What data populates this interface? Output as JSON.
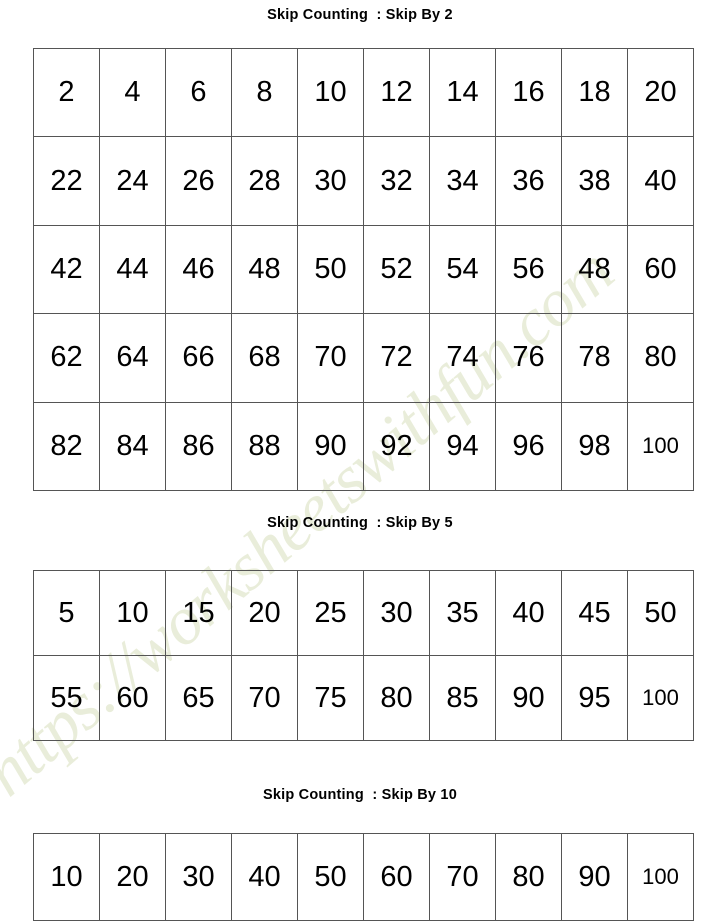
{
  "watermark": {
    "text": "https://worksheetswithfun.com",
    "color": "#e9edda"
  },
  "sections": [
    {
      "id": "skip-2",
      "title": "Skip Counting  : Skip By 2",
      "step": 2,
      "rows": [
        [
          "2",
          "4",
          "6",
          "8",
          "10",
          "12",
          "14",
          "16",
          "18",
          "20"
        ],
        [
          "22",
          "24",
          "26",
          "28",
          "30",
          "32",
          "34",
          "36",
          "38",
          "40"
        ],
        [
          "42",
          "44",
          "46",
          "48",
          "50",
          "52",
          "54",
          "56",
          "48",
          "60"
        ],
        [
          "62",
          "64",
          "66",
          "68",
          "70",
          "72",
          "74",
          "76",
          "78",
          "80"
        ],
        [
          "82",
          "84",
          "86",
          "88",
          "90",
          "92",
          "94",
          "96",
          "98",
          "100"
        ]
      ]
    },
    {
      "id": "skip-5",
      "title": "Skip Counting  : Skip By 5",
      "step": 5,
      "rows": [
        [
          "5",
          "10",
          "15",
          "20",
          "25",
          "30",
          "35",
          "40",
          "45",
          "50"
        ],
        [
          "55",
          "60",
          "65",
          "70",
          "75",
          "80",
          "85",
          "90",
          "95",
          "100"
        ]
      ]
    },
    {
      "id": "skip-10",
      "title": "Skip Counting  : Skip By 10",
      "step": 10,
      "rows": [
        [
          "10",
          "20",
          "30",
          "40",
          "50",
          "60",
          "70",
          "80",
          "90",
          "100"
        ]
      ]
    }
  ]
}
